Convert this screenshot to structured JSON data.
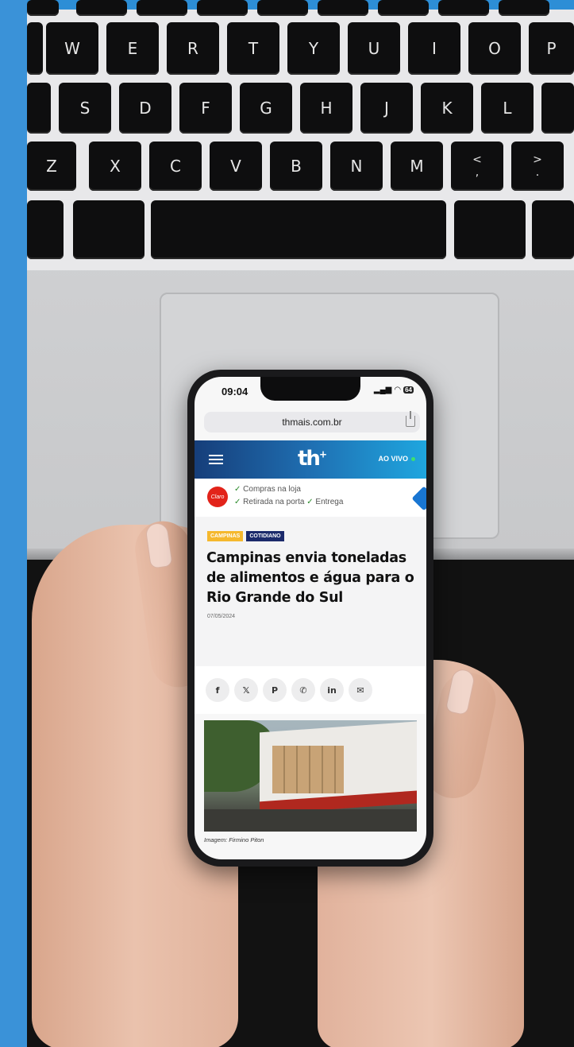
{
  "keyboard": {
    "row1": [
      "W",
      "E",
      "R",
      "T",
      "Y",
      "U",
      "I",
      "O",
      "P"
    ],
    "row2": [
      "S",
      "D",
      "F",
      "G",
      "H",
      "J",
      "K",
      "L"
    ],
    "row3": [
      "Z",
      "X",
      "C",
      "V",
      "B",
      "N",
      "M"
    ],
    "row3_symbols": [
      {
        "top": "<",
        "bottom": ","
      },
      {
        "top": ">",
        "bottom": "."
      }
    ]
  },
  "phone": {
    "status": {
      "time": "09:04",
      "battery": "64"
    },
    "browser": {
      "url": "thmais.com.br"
    },
    "site": {
      "logo": "th",
      "logo_sup": "+",
      "live_label": "AO VIVO"
    },
    "ad": {
      "brand": "Claro",
      "line1": "Compras na loja",
      "line2": "Retirada na porta",
      "line3": "Entrega"
    },
    "article": {
      "tags": [
        "CAMPINAS",
        "COTIDIANO"
      ],
      "headline": "Campinas envia toneladas de alimentos e água para o Rio Grande do Sul",
      "date": "07/05/2024",
      "share_buttons": [
        "f",
        "𝕏",
        "P",
        "✆",
        "in",
        "✉"
      ],
      "image_caption": "Imagem: Firmino Piton"
    }
  },
  "colors": {
    "blue_strip": "#3a92d8",
    "header_gradient_start": "#163e7a",
    "header_gradient_end": "#1fa6df",
    "tag_campinas": "#f5b82e",
    "tag_cotidiano": "#1b2a6b",
    "claro_red": "#e2231a"
  }
}
